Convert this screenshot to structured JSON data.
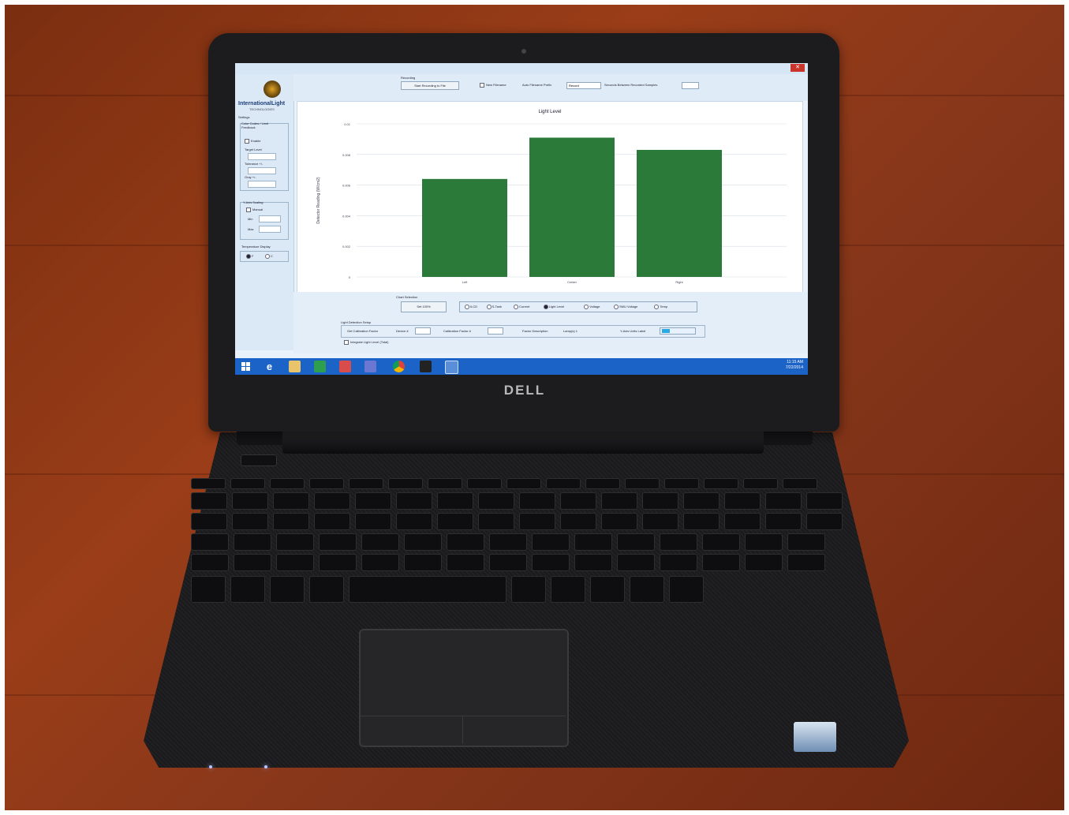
{
  "brand": {
    "laptop_logo": "DELL"
  },
  "app": {
    "window_title": "",
    "logo_name": "InternationalLight",
    "logo_sub": "TECHNOLOGIES",
    "sidebar": {
      "settings_label": "Settings",
      "color_section": "Color Codes / Limit Feedback",
      "enable_label": "Enable",
      "target_label": "Target Level",
      "tolerance_label": "Tolerance +/-",
      "gray_label": "Gray +/-",
      "yaxis_section": "Y-Axis Scaling",
      "manual_label": "Manual",
      "min_label": "Min",
      "max_label": "Max",
      "temp_section": "Temperature Display",
      "temp_f": "F",
      "temp_c": "C"
    },
    "top": {
      "recording_section": "Recording",
      "start_button": "Start Recording to File",
      "new_filename_label": "New Filename",
      "auto_filename_label": "Auto Filename Prefix",
      "prefix_value": "Record",
      "seconds_label": "Seconds Between Recorded Samples"
    },
    "bottom": {
      "chart_section": "Chart Selection",
      "set_button": "Set 100%",
      "radio_options": [
        "ILCD",
        "S-Tank",
        "Current",
        "Light Level",
        "Voltage",
        "SMU Voltage",
        "Temp"
      ],
      "radio_selected": "Light Level",
      "detector_section": "Light Detection Setup",
      "cal_factor_label": "Get Calibration Factor",
      "device_label": "Device #",
      "calibration_label": "Calibration Factor #",
      "factor_desc_label": "Factor Description",
      "factor_desc_value": "Lamp(s) 1",
      "yaxis_units_label": "Y-Axis Units Label",
      "integrate_label": "Integrate Light Level (Total)"
    },
    "clock": {
      "time": "11:15 AM",
      "date": "7/22/2014"
    }
  },
  "chart_data": {
    "type": "bar",
    "title": "Light Level",
    "xlabel": "",
    "ylabel": "Detector Reading (W/cm2)",
    "categories": [
      "Left",
      "Center",
      "Right"
    ],
    "values": [
      0.0064,
      0.0091,
      0.0083
    ],
    "ylim": [
      0,
      0.01
    ],
    "yticks": [
      "0",
      "0.002",
      "0.004",
      "0.006",
      "0.008",
      "0.01"
    ],
    "bar_color": "#2b7a3a",
    "grid": true
  },
  "taskbar_icons": [
    "windows-start-icon",
    "internet-explorer-icon",
    "file-explorer-icon",
    "store-icon",
    "paint-icon",
    "media-icon",
    "chrome-icon",
    "terminal-icon",
    "light-app-icon"
  ]
}
